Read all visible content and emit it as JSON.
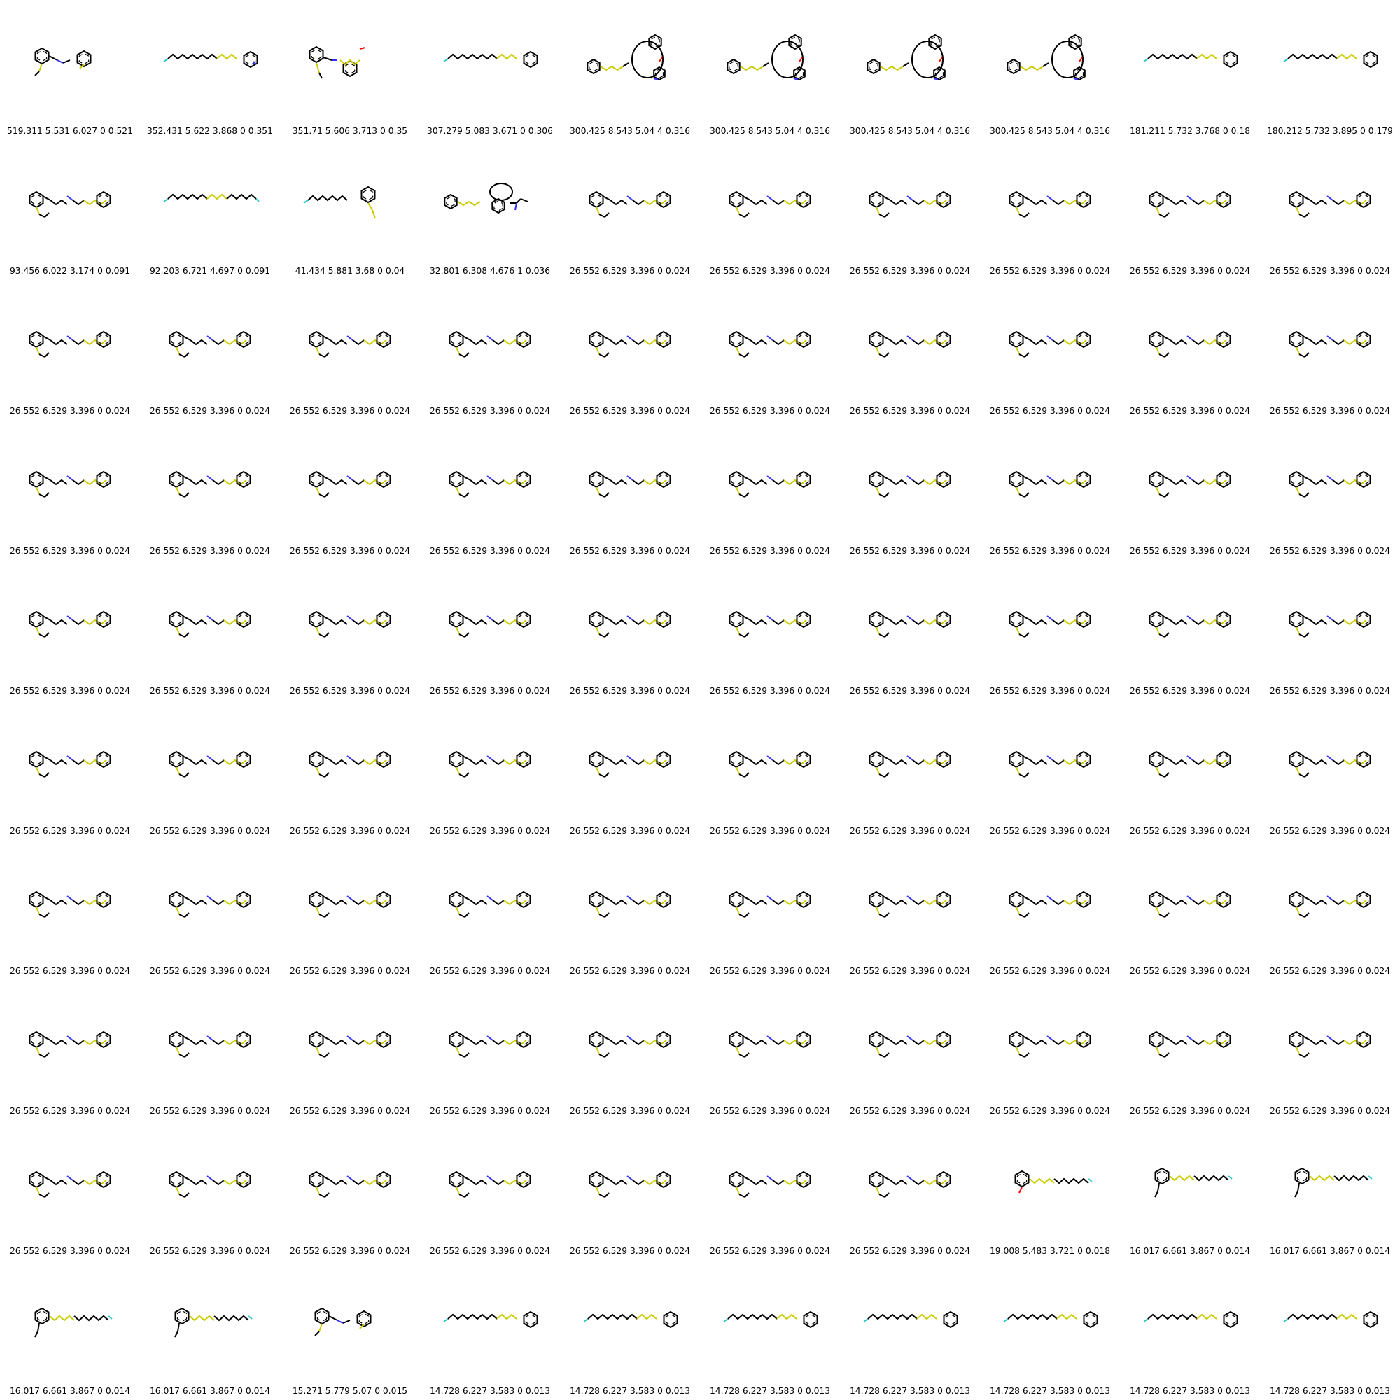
{
  "colors": {
    "bond": "#000000",
    "sulfur": "#cccc00",
    "nitrogen": "#2f2fff",
    "oxygen": "#ff0000",
    "fluorine": "#33cccc"
  },
  "cells": [
    {
      "label": "519.311 5.531 6.027 0 0.521",
      "shape": "aromatic-amine"
    },
    {
      "label": "352.431 5.622 3.868 0 0.351",
      "shape": "chain-pyridine"
    },
    {
      "label": "351.71 5.606 3.713 0 0.35",
      "shape": "diaryl-amine"
    },
    {
      "label": "307.279 5.083 3.671 0 0.306",
      "shape": "chain-benzene"
    },
    {
      "label": "300.425 8.543 5.04 4 0.316",
      "shape": "macrocycle"
    },
    {
      "label": "300.425 8.543 5.04 4 0.316",
      "shape": "macrocycle"
    },
    {
      "label": "300.425 8.543 5.04 4 0.316",
      "shape": "macrocycle"
    },
    {
      "label": "300.425 8.543 5.04 4 0.316",
      "shape": "macrocycle"
    },
    {
      "label": "181.211 5.732 3.768 0 0.18",
      "shape": "chain-benzene"
    },
    {
      "label": "180.212 5.732 3.895 0 0.179",
      "shape": "chain-benzene"
    },
    {
      "label": "93.456 6.022 3.174 0 0.091",
      "shape": "styryl-chain"
    },
    {
      "label": "92.203 6.721 4.697 0 0.091",
      "shape": "long-chain"
    },
    {
      "label": "41.434 5.881 3.68 0 0.04",
      "shape": "chain-aryl-s"
    },
    {
      "label": "32.801 6.308 4.676 1 0.036",
      "shape": "fused-ring"
    },
    {
      "label": "26.552 6.529 3.396 0 0.024",
      "shape": "styryl-chain"
    },
    {
      "label": "26.552 6.529 3.396 0 0.024",
      "shape": "styryl-chain"
    },
    {
      "label": "26.552 6.529 3.396 0 0.024",
      "shape": "styryl-chain"
    },
    {
      "label": "26.552 6.529 3.396 0 0.024",
      "shape": "styryl-chain"
    },
    {
      "label": "26.552 6.529 3.396 0 0.024",
      "shape": "styryl-chain"
    },
    {
      "label": "26.552 6.529 3.396 0 0.024",
      "shape": "styryl-chain"
    },
    {
      "label": "26.552 6.529 3.396 0 0.024",
      "shape": "styryl-chain"
    },
    {
      "label": "26.552 6.529 3.396 0 0.024",
      "shape": "styryl-chain"
    },
    {
      "label": "26.552 6.529 3.396 0 0.024",
      "shape": "styryl-chain"
    },
    {
      "label": "26.552 6.529 3.396 0 0.024",
      "shape": "styryl-chain"
    },
    {
      "label": "26.552 6.529 3.396 0 0.024",
      "shape": "styryl-chain"
    },
    {
      "label": "26.552 6.529 3.396 0 0.024",
      "shape": "styryl-chain"
    },
    {
      "label": "26.552 6.529 3.396 0 0.024",
      "shape": "styryl-chain"
    },
    {
      "label": "26.552 6.529 3.396 0 0.024",
      "shape": "styryl-chain"
    },
    {
      "label": "26.552 6.529 3.396 0 0.024",
      "shape": "styryl-chain"
    },
    {
      "label": "26.552 6.529 3.396 0 0.024",
      "shape": "styryl-chain"
    },
    {
      "label": "26.552 6.529 3.396 0 0.024",
      "shape": "styryl-chain"
    },
    {
      "label": "26.552 6.529 3.396 0 0.024",
      "shape": "styryl-chain"
    },
    {
      "label": "26.552 6.529 3.396 0 0.024",
      "shape": "styryl-chain"
    },
    {
      "label": "26.552 6.529 3.396 0 0.024",
      "shape": "styryl-chain"
    },
    {
      "label": "26.552 6.529 3.396 0 0.024",
      "shape": "styryl-chain"
    },
    {
      "label": "26.552 6.529 3.396 0 0.024",
      "shape": "styryl-chain"
    },
    {
      "label": "26.552 6.529 3.396 0 0.024",
      "shape": "styryl-chain"
    },
    {
      "label": "26.552 6.529 3.396 0 0.024",
      "shape": "styryl-chain"
    },
    {
      "label": "26.552 6.529 3.396 0 0.024",
      "shape": "styryl-chain"
    },
    {
      "label": "26.552 6.529 3.396 0 0.024",
      "shape": "styryl-chain"
    },
    {
      "label": "26.552 6.529 3.396 0 0.024",
      "shape": "styryl-chain"
    },
    {
      "label": "26.552 6.529 3.396 0 0.024",
      "shape": "styryl-chain"
    },
    {
      "label": "26.552 6.529 3.396 0 0.024",
      "shape": "styryl-chain"
    },
    {
      "label": "26.552 6.529 3.396 0 0.024",
      "shape": "styryl-chain"
    },
    {
      "label": "26.552 6.529 3.396 0 0.024",
      "shape": "styryl-chain"
    },
    {
      "label": "26.552 6.529 3.396 0 0.024",
      "shape": "styryl-chain"
    },
    {
      "label": "26.552 6.529 3.396 0 0.024",
      "shape": "styryl-chain"
    },
    {
      "label": "26.552 6.529 3.396 0 0.024",
      "shape": "styryl-chain"
    },
    {
      "label": "26.552 6.529 3.396 0 0.024",
      "shape": "styryl-chain"
    },
    {
      "label": "26.552 6.529 3.396 0 0.024",
      "shape": "styryl-chain"
    },
    {
      "label": "26.552 6.529 3.396 0 0.024",
      "shape": "styryl-chain"
    },
    {
      "label": "26.552 6.529 3.396 0 0.024",
      "shape": "styryl-chain"
    },
    {
      "label": "26.552 6.529 3.396 0 0.024",
      "shape": "styryl-chain"
    },
    {
      "label": "26.552 6.529 3.396 0 0.024",
      "shape": "styryl-chain"
    },
    {
      "label": "26.552 6.529 3.396 0 0.024",
      "shape": "styryl-chain"
    },
    {
      "label": "26.552 6.529 3.396 0 0.024",
      "shape": "styryl-chain"
    },
    {
      "label": "26.552 6.529 3.396 0 0.024",
      "shape": "styryl-chain"
    },
    {
      "label": "26.552 6.529 3.396 0 0.024",
      "shape": "styryl-chain"
    },
    {
      "label": "26.552 6.529 3.396 0 0.024",
      "shape": "styryl-chain"
    },
    {
      "label": "26.552 6.529 3.396 0 0.024",
      "shape": "styryl-chain"
    },
    {
      "label": "26.552 6.529 3.396 0 0.024",
      "shape": "styryl-chain"
    },
    {
      "label": "26.552 6.529 3.396 0 0.024",
      "shape": "styryl-chain"
    },
    {
      "label": "26.552 6.529 3.396 0 0.024",
      "shape": "styryl-chain"
    },
    {
      "label": "26.552 6.529 3.396 0 0.024",
      "shape": "styryl-chain"
    },
    {
      "label": "26.552 6.529 3.396 0 0.024",
      "shape": "styryl-chain"
    },
    {
      "label": "26.552 6.529 3.396 0 0.024",
      "shape": "styryl-chain"
    },
    {
      "label": "26.552 6.529 3.396 0 0.024",
      "shape": "styryl-chain"
    },
    {
      "label": "26.552 6.529 3.396 0 0.024",
      "shape": "styryl-chain"
    },
    {
      "label": "26.552 6.529 3.396 0 0.024",
      "shape": "styryl-chain"
    },
    {
      "label": "26.552 6.529 3.396 0 0.024",
      "shape": "styryl-chain"
    },
    {
      "label": "26.552 6.529 3.396 0 0.024",
      "shape": "styryl-chain"
    },
    {
      "label": "26.552 6.529 3.396 0 0.024",
      "shape": "styryl-chain"
    },
    {
      "label": "26.552 6.529 3.396 0 0.024",
      "shape": "styryl-chain"
    },
    {
      "label": "26.552 6.529 3.396 0 0.024",
      "shape": "styryl-chain"
    },
    {
      "label": "26.552 6.529 3.396 0 0.024",
      "shape": "styryl-chain"
    },
    {
      "label": "26.552 6.529 3.396 0 0.024",
      "shape": "styryl-chain"
    },
    {
      "label": "26.552 6.529 3.396 0 0.024",
      "shape": "styryl-chain"
    },
    {
      "label": "26.552 6.529 3.396 0 0.024",
      "shape": "styryl-chain"
    },
    {
      "label": "26.552 6.529 3.396 0 0.024",
      "shape": "styryl-chain"
    },
    {
      "label": "26.552 6.529 3.396 0 0.024",
      "shape": "styryl-chain"
    },
    {
      "label": "26.552 6.529 3.396 0 0.024",
      "shape": "styryl-chain"
    },
    {
      "label": "26.552 6.529 3.396 0 0.024",
      "shape": "styryl-chain"
    },
    {
      "label": "26.552 6.529 3.396 0 0.024",
      "shape": "styryl-chain"
    },
    {
      "label": "26.552 6.529 3.396 0 0.024",
      "shape": "styryl-chain"
    },
    {
      "label": "26.552 6.529 3.396 0 0.024",
      "shape": "styryl-chain"
    },
    {
      "label": "26.552 6.529 3.396 0 0.024",
      "shape": "styryl-chain"
    },
    {
      "label": "26.552 6.529 3.396 0 0.024",
      "shape": "styryl-chain"
    },
    {
      "label": "19.008 5.483 3.721 0 0.018",
      "shape": "aryl-chain-o"
    },
    {
      "label": "16.017 6.661 3.867 0 0.014",
      "shape": "aryl-chain"
    },
    {
      "label": "16.017 6.661 3.867 0 0.014",
      "shape": "aryl-chain"
    },
    {
      "label": "16.017 6.661 3.867 0 0.014",
      "shape": "aryl-chain"
    },
    {
      "label": "16.017 6.661 3.867 0 0.014",
      "shape": "aryl-chain"
    },
    {
      "label": "15.271 5.779 5.07 0 0.015",
      "shape": "aromatic-amine"
    },
    {
      "label": "14.728 6.227 3.583 0 0.013",
      "shape": "chain-benzene"
    },
    {
      "label": "14.728 6.227 3.583 0 0.013",
      "shape": "chain-benzene"
    },
    {
      "label": "14.728 6.227 3.583 0 0.013",
      "shape": "chain-benzene"
    },
    {
      "label": "14.728 6.227 3.583 0 0.013",
      "shape": "chain-benzene"
    },
    {
      "label": "14.728 6.227 3.583 0 0.013",
      "shape": "chain-benzene"
    },
    {
      "label": "14.728 6.227 3.583 0 0.013",
      "shape": "chain-benzene"
    },
    {
      "label": "14.728 6.227 3.583 0 0.013",
      "shape": "chain-benzene"
    }
  ]
}
